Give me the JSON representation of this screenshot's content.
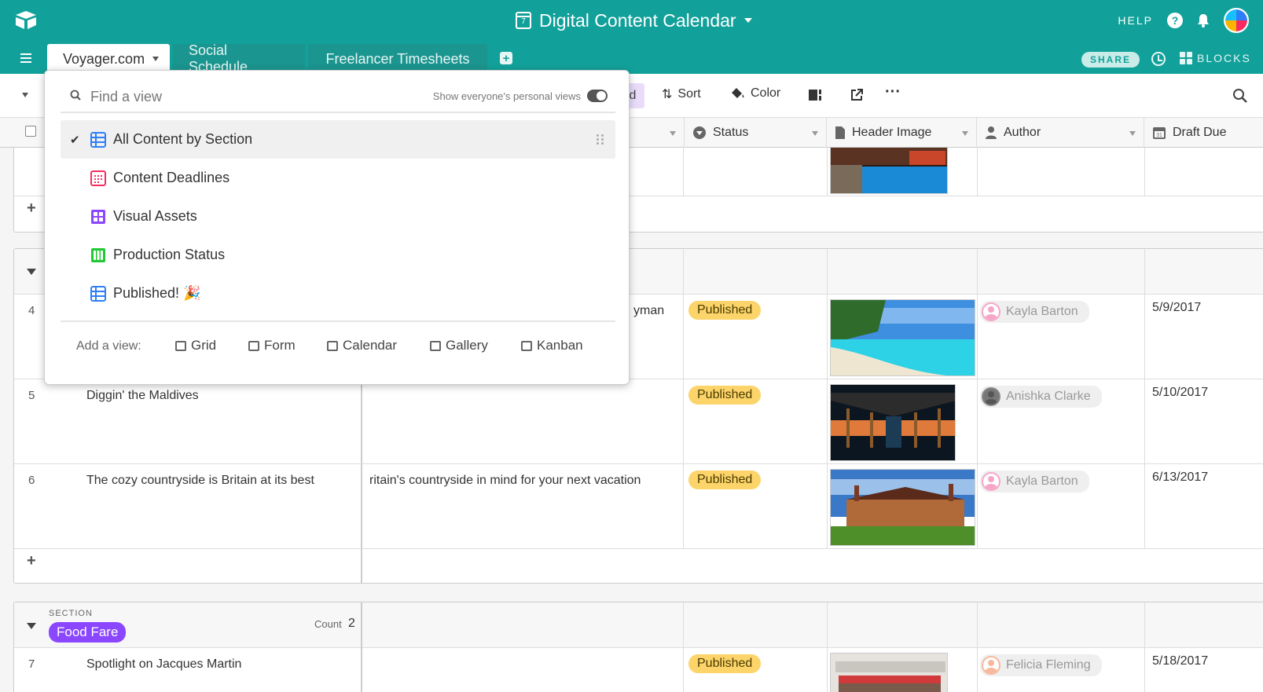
{
  "header": {
    "base_title": "Digital Content Calendar",
    "calendar_icon_day": "7",
    "help_label": "HELP",
    "share_label": "SHARE",
    "blocks_label": "BLOCKS",
    "accent_color": "#12a19a"
  },
  "tabs": [
    {
      "label": "Voyager.com",
      "active": true
    },
    {
      "label": "Social Schedule",
      "active": false
    },
    {
      "label": "Freelancer Timesheets",
      "active": false
    }
  ],
  "toolbar": {
    "partial_label": "d",
    "sort_label": "Sort",
    "color_label": "Color",
    "more_label": "···"
  },
  "columns": {
    "status": "Status",
    "header_image": "Header Image",
    "author": "Author",
    "draft_due": "Draft Due"
  },
  "rows": [
    {
      "num": "4",
      "title": "",
      "desc_fragment": "yman",
      "status": "Published",
      "author": "Kayla Barton",
      "draft_due": "5/9/2017"
    },
    {
      "num": "5",
      "title": "Diggin' the Maldives",
      "desc_fragment": "",
      "status": "Published",
      "author": "Anishka Clarke",
      "draft_due": "5/10/2017"
    },
    {
      "num": "6",
      "title": "The cozy countryside is Britain at its best",
      "desc_fragment": "ritain's countryside in mind for your next vacation",
      "status": "Published",
      "author": "Kayla Barton",
      "draft_due": "6/13/2017"
    },
    {
      "num": "7",
      "title": "Spotlight on Jacques Martin",
      "desc_fragment": "",
      "status": "Published",
      "author": "Felicia Fleming",
      "draft_due": "5/18/2017"
    }
  ],
  "section_group": {
    "caption": "SECTION",
    "name": "Food Fare",
    "count_label": "Count",
    "count": "2",
    "pill_color": "#8b46ff"
  },
  "view_switcher": {
    "search_placeholder": "Find a view",
    "toggle_label": "Show everyone's personal views",
    "views": [
      {
        "label": "All Content by Section",
        "icon": "grid-view-icon",
        "color": "#2d7ff9",
        "selected": true
      },
      {
        "label": "Content Deadlines",
        "icon": "calendar-view-icon",
        "color": "#f82b60",
        "selected": false
      },
      {
        "label": "Visual Assets",
        "icon": "gallery-view-icon",
        "color": "#8b46ff",
        "selected": false
      },
      {
        "label": "Production Status",
        "icon": "kanban-view-icon",
        "color": "#20c933",
        "selected": false
      },
      {
        "label": "Published! 🎉",
        "icon": "grid-view-icon",
        "color": "#2d7ff9",
        "selected": false
      }
    ],
    "add_view_label": "Add a view:",
    "add_options": [
      "Grid",
      "Form",
      "Calendar",
      "Gallery",
      "Kanban"
    ]
  },
  "status_color": "#fcd46a"
}
